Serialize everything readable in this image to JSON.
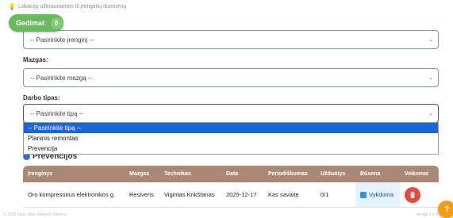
{
  "loading_note": "Lokacijų užkraunamos iš įrenginių duomenų",
  "badge": {
    "label": "Gedimai:",
    "count": "0"
  },
  "device_select": {
    "value": "-- Pasirinkite įrenginį --"
  },
  "node_field": {
    "label": "Mazgas:",
    "value": "-- Pasirinkite mazgą --"
  },
  "work_type_field": {
    "label": "Darbo tipas:",
    "value": "-- Pasirinkite tipą --",
    "options": [
      "-- Pasirinkite tipą --",
      "Planinis remontas",
      "Prevencija"
    ]
  },
  "section": {
    "title": "Prevencijos"
  },
  "table": {
    "headers": [
      "Įrenginys",
      "Mazgas",
      "Technikas",
      "Data",
      "Periodiškumas",
      "Užduotys",
      "Būsena",
      "Veiksmai"
    ],
    "rows": [
      {
        "device": "Oro kompresorius elektronikos g.",
        "node": "Resiveris",
        "technician": "Vigintas Krikštanas",
        "date": "2025-12-17",
        "period": "Kas savaitę",
        "tasks": "0/1",
        "status": "Vykdoma"
      }
    ]
  },
  "footer": {
    "left": "© 2025 Turto Ūkio Valdymo Sistema",
    "right": "Versija 1.0 © 2025"
  },
  "help": {
    "label": "?"
  },
  "colors": {
    "badge": "#68b85e",
    "table_header": "#a98876",
    "selected_option": "#1d64d6",
    "delete": "#e24a43",
    "help": "#f39c12"
  },
  "icons": {
    "delete": "trash-icon",
    "status": "status-square-icon",
    "chevron": "chevron-down-icon"
  }
}
